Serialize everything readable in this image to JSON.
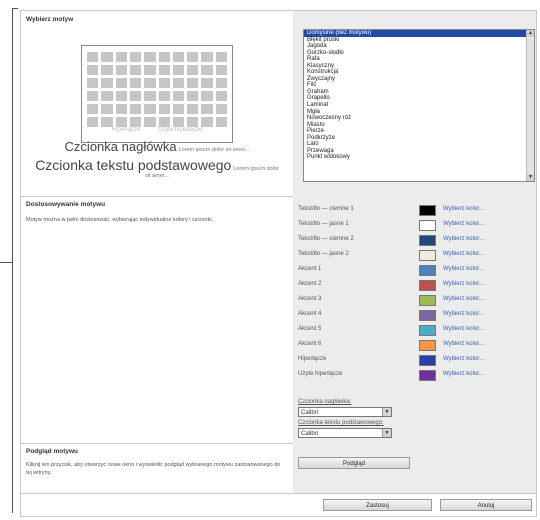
{
  "sections": {
    "select_theme": {
      "title": "Wybierz motyw"
    },
    "customize": {
      "title": "Dostosowywanie motywu",
      "description": "Motyw można w pełni dostosować, wybierając indywidualne kolory i czcionki."
    },
    "preview": {
      "title": "Podgląd motywu",
      "description": "Kliknij ten przycisk, aby otworzyć nowe okno i wyświetlić podgląd wybranego motywu zastosowanego do tej witryny."
    }
  },
  "theme_preview": {
    "hyperlink": "Hiperłącze",
    "visited_hyperlink": "Użyte hiperłącze",
    "heading_font": "Czcionka nagłówka",
    "heading_lorem": "Lorem ipsum dolor sit amet...",
    "body_font": "Czcionka tekstu podstawowego",
    "body_lorem_1": "Lorem ipsum dolor",
    "body_lorem_2": "sit amet..."
  },
  "theme_list": {
    "selected_index": 0,
    "items": [
      "Domyślne (bez motywu)",
      "Błękit pruski",
      "Jagoda",
      "Gorzko-słodki",
      "Rafa",
      "Klasyczny",
      "Konstrukcja",
      "Zwyczajny",
      "Filc",
      "Graham",
      "Grapello",
      "Laminat",
      "Mgła",
      "Nowoczesny róż",
      "Miasto",
      "Pierze",
      "Podkrzyże",
      "Lato",
      "Przewaga",
      "Punkt widokowy"
    ]
  },
  "colors": {
    "pick_label": "Wybierz kolor...",
    "items": [
      {
        "label": "Tekst/tło — ciemne 1",
        "color": "#000000"
      },
      {
        "label": "Tekst/tło — jasne 1",
        "color": "#ffffff"
      },
      {
        "label": "Tekst/tło — ciemne 2",
        "color": "#1f497d"
      },
      {
        "label": "Tekst/tło — jasne 2",
        "color": "#eeece1"
      },
      {
        "label": "Akcent 1",
        "color": "#4f81bd"
      },
      {
        "label": "Akcent 2",
        "color": "#c0504d"
      },
      {
        "label": "Akcent 3",
        "color": "#9bbb59"
      },
      {
        "label": "Akcent 4",
        "color": "#8064a2"
      },
      {
        "label": "Akcent 5",
        "color": "#4bacc6"
      },
      {
        "label": "Akcent 6",
        "color": "#f79646"
      },
      {
        "label": "Hiperłącze",
        "color": "#2b3fa6"
      },
      {
        "label": "Użyte hiperłącze",
        "color": "#7030a0"
      }
    ]
  },
  "fonts": {
    "heading_label": "Czcionka nagłówka:",
    "heading_value": "Calibri",
    "body_label": "Czcionka tekstu podstawowego:",
    "body_value": "Calibri"
  },
  "buttons": {
    "preview": "Podgląd",
    "apply": "Zastosuj",
    "cancel": "Anuluj"
  }
}
